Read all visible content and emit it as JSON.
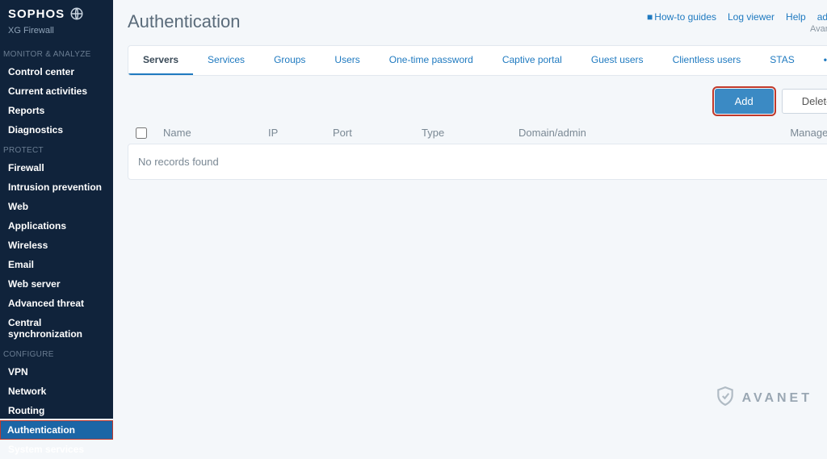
{
  "brand": {
    "name": "SOPHOS",
    "subtitle": "XG Firewall"
  },
  "sidebar": {
    "sections": [
      {
        "header": "MONITOR & ANALYZE",
        "items": [
          "Control center",
          "Current activities",
          "Reports",
          "Diagnostics"
        ]
      },
      {
        "header": "PROTECT",
        "items": [
          "Firewall",
          "Intrusion prevention",
          "Web",
          "Applications",
          "Wireless",
          "Email",
          "Web server",
          "Advanced threat",
          "Central synchronization"
        ]
      },
      {
        "header": "CONFIGURE",
        "items": [
          "VPN",
          "Network",
          "Routing",
          "Authentication",
          "System services"
        ],
        "active_index": 3
      }
    ]
  },
  "header": {
    "title": "Authentication",
    "links": {
      "guides": "How-to guides",
      "logviewer": "Log viewer",
      "help": "Help",
      "user": "admin"
    },
    "org": "Avanet AG"
  },
  "tabs": [
    "Servers",
    "Services",
    "Groups",
    "Users",
    "One-time password",
    "Captive portal",
    "Guest users",
    "Clientless users",
    "STAS"
  ],
  "active_tab": 0,
  "actions": {
    "add": "Add",
    "delete": "Delete"
  },
  "table": {
    "columns": {
      "name": "Name",
      "ip": "IP",
      "port": "Port",
      "type": "Type",
      "domain": "Domain/admin",
      "manage": "Manage"
    },
    "empty": "No records found"
  },
  "watermark": "AVANET"
}
